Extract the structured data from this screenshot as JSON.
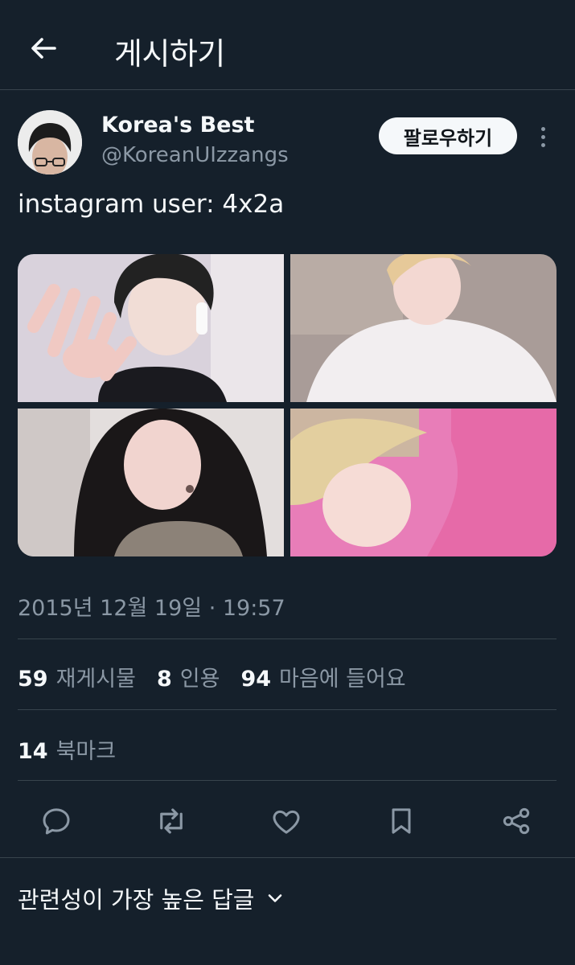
{
  "header": {
    "title": "게시하기",
    "back_icon": "arrow-left-icon"
  },
  "post": {
    "author": {
      "display_name": "Korea's Best",
      "handle": "@KoreanUIzzangs",
      "avatar_icon": "avatar"
    },
    "follow_label": "팔로우하기",
    "text": "instagram user: 4x2a",
    "media": [
      {
        "name": "photo-1"
      },
      {
        "name": "photo-2"
      },
      {
        "name": "photo-3"
      },
      {
        "name": "photo-4"
      }
    ],
    "timestamp": "2015년 12월 19일 · 19:57",
    "stats": {
      "reposts": {
        "count": "59",
        "label": "재게시물"
      },
      "quotes": {
        "count": "8",
        "label": "인용"
      },
      "likes": {
        "count": "94",
        "label": "마음에 들어요"
      },
      "bookmarks": {
        "count": "14",
        "label": "북마크"
      }
    },
    "actions": [
      "reply-icon",
      "repost-icon",
      "like-icon",
      "bookmark-icon",
      "share-icon"
    ]
  },
  "replies_sort": {
    "label": "관련성이 가장 높은 답글"
  },
  "colors": {
    "background": "#15202b",
    "text": "#f5f8fa",
    "secondary_text": "#8b98a5",
    "divider": "#38444d"
  }
}
